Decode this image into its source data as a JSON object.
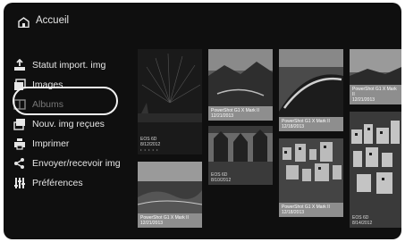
{
  "header": {
    "title": "Accueil"
  },
  "sidebar": {
    "items": [
      {
        "label": "Statut import. img",
        "icon": "upload-icon"
      },
      {
        "label": "Images",
        "icon": "images-icon"
      },
      {
        "label": "Albums",
        "icon": "album-icon",
        "selected": true
      },
      {
        "label": "Nouv. img reçues",
        "icon": "inbox-icon"
      },
      {
        "label": "Imprimer",
        "icon": "printer-icon"
      },
      {
        "label": "Envoyer/recevoir img",
        "icon": "share-icon"
      },
      {
        "label": "Préférences",
        "icon": "settings-icon"
      }
    ]
  },
  "albums": [
    {
      "camera": "EOS 6D",
      "date": "8/12/2012",
      "dots": "• • • • •"
    },
    {
      "camera": "PowerShot G1 X Mark II",
      "date": "12/21/2013"
    },
    {
      "camera": "PowerShot G1 X Mark II",
      "date": "12/21/2013"
    },
    {
      "camera": "EOS 6D",
      "date": "8/10/2012"
    },
    {
      "camera": "PowerShot G1 X Mark II",
      "date": "12/18/2013"
    },
    {
      "camera": "PowerShot G1 X Mark II",
      "date": "12/18/2013"
    },
    {
      "camera": "PowerShot G1 X Mark II",
      "date": "12/21/2013"
    },
    {
      "camera": "EOS 6D",
      "date": "8/14/2012"
    }
  ],
  "colors": {
    "background": "#0f0f0f",
    "caption_bar": "#8e8e8e",
    "text": "#e6e6e6"
  }
}
